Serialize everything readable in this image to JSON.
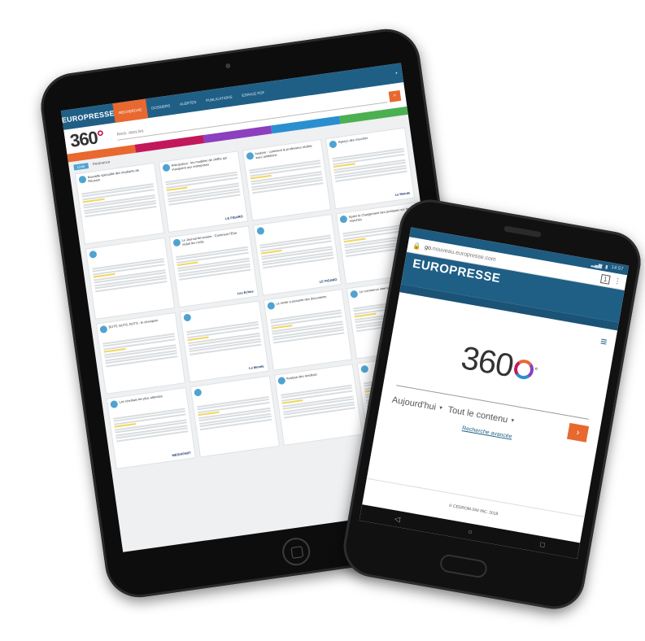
{
  "tablet": {
    "brand": "EUROPRESSE",
    "nav_items": [
      "RECHERCHE",
      "DOSSIERS",
      "ALERTES",
      "PUBLICATIONS",
      "ESPACE PDF"
    ],
    "search_placeholder": "Rech. dans les",
    "search_icon": "search-icon",
    "filters": [
      {
        "label": "",
        "color": "#e8682f"
      },
      {
        "label": "",
        "color": "#c2185b"
      },
      {
        "label": "",
        "color": "#8c3fbf"
      },
      {
        "label": "",
        "color": "#2a8fd0"
      },
      {
        "label": "",
        "color": "#4caf50"
      }
    ],
    "sort_badge": "Liste",
    "sort_label": "Pertinence",
    "cards": [
      {
        "title": "Nouvelle spécialité des étudiants de Réunion",
        "source": ""
      },
      {
        "title": "Anticipation : les modèles de chiffre qui manquent aux entreprises",
        "source": "LE FIGARO"
      },
      {
        "title": "Analyse : comment le professeur réalise leurs ambitions",
        "source": ""
      },
      {
        "title": "Aperçu des marchés",
        "source": "Le Monde"
      },
      {
        "title": "",
        "source": ""
      },
      {
        "title": "Le Journal ferroviaire : Comment l'Etat réduit les coûts",
        "source": "Les Echos"
      },
      {
        "title": "",
        "source": "LE FIGARO"
      },
      {
        "title": "Après le changement des pratiques sur les marchés",
        "source": ""
      },
      {
        "title": "BUTS, BUTS, BUTS : le champion",
        "source": ""
      },
      {
        "title": "",
        "source": "Le Monde"
      },
      {
        "title": "La vente croissante des documents",
        "source": ""
      },
      {
        "title": "Le commerce international",
        "source": ""
      },
      {
        "title": "Les résultats les plus attendus",
        "source": "MEDIAPART"
      },
      {
        "title": "",
        "source": ""
      },
      {
        "title": "Analyse des résultats",
        "source": ""
      },
      {
        "title": "",
        "source": ""
      }
    ]
  },
  "phone": {
    "status_time": "14:57",
    "url_prefix": "go.",
    "url_domain": "nouveau.europresse.com",
    "brand": "EUROPRESSE",
    "tagline": "",
    "logo_text": "360",
    "logo_suffix": "°",
    "period_select": "Aujourd'hui",
    "content_select": "Tout le contenu",
    "go_icon": "›",
    "advanced_search": "Recherche avancée",
    "footer": "© CEDROM-SNI INC. 2018"
  }
}
